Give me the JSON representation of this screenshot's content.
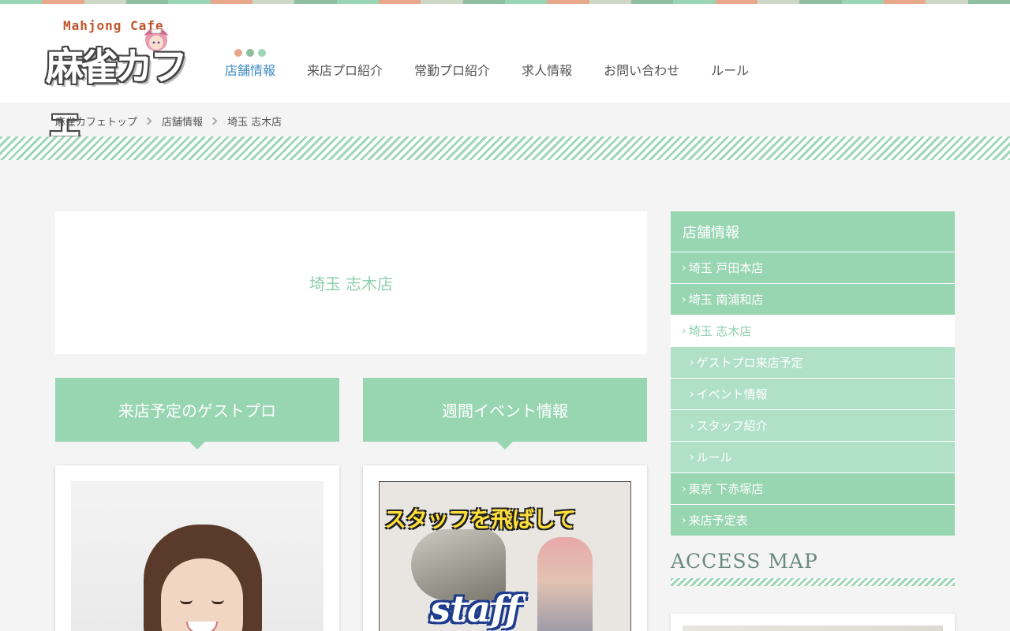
{
  "colors": {
    "accent": "#98d6b2",
    "accent_light": "#b0e0c6",
    "active_nav": "#3c8cc4",
    "title_text": "#8fcfae",
    "dot_1": "#e8a88a",
    "dot_2": "#8fbf9f",
    "dot_3": "#9ad6b5",
    "stripe": [
      "#9ad6b5",
      "#e8a88a",
      "#cfd8c6",
      "#8fbf9f"
    ]
  },
  "logo": {
    "en": "Mahjong Cafe",
    "ja": "麻雀カフェ",
    "mascot_icon": "mascot-girl-icon"
  },
  "nav": {
    "items": [
      {
        "label": "店舗情報",
        "active": true
      },
      {
        "label": "来店プロ紹介",
        "active": false
      },
      {
        "label": "常勤プロ紹介",
        "active": false
      },
      {
        "label": "求人情報",
        "active": false
      },
      {
        "label": "お問い合わせ",
        "active": false
      },
      {
        "label": "ルール",
        "active": false
      }
    ]
  },
  "breadcrumb": {
    "items": [
      "麻雀カフェトップ",
      "店舗情報",
      "埼玉 志木店"
    ],
    "separator_icon": "chevron-right-icon"
  },
  "main": {
    "page_title": "埼玉 志木店",
    "sections": [
      {
        "heading": "来店予定のゲストプロ"
      },
      {
        "heading": "週間イベント情報"
      }
    ],
    "poster": {
      "title": "スタッフを飛ばして",
      "word": "staff"
    }
  },
  "sidebar": {
    "heading": "店舗情報",
    "items": [
      {
        "label": "埼玉 戸田本店",
        "level": 0,
        "current": false
      },
      {
        "label": "埼玉 南浦和店",
        "level": 0,
        "current": false
      },
      {
        "label": "埼玉 志木店",
        "level": 0,
        "current": true
      },
      {
        "label": "ゲストプロ来店予定",
        "level": 1,
        "current": false
      },
      {
        "label": "イベント情報",
        "level": 1,
        "current": false
      },
      {
        "label": "スタッフ紹介",
        "level": 1,
        "current": false
      },
      {
        "label": "ルール",
        "level": 1,
        "current": false
      },
      {
        "label": "東京 下赤塚店",
        "level": 0,
        "current": false
      },
      {
        "label": "来店予定表",
        "level": 0,
        "current": false
      }
    ],
    "chevron": "›",
    "chevron_icon": "chevron-right-icon"
  },
  "access": {
    "title": "ACCESS MAP"
  }
}
